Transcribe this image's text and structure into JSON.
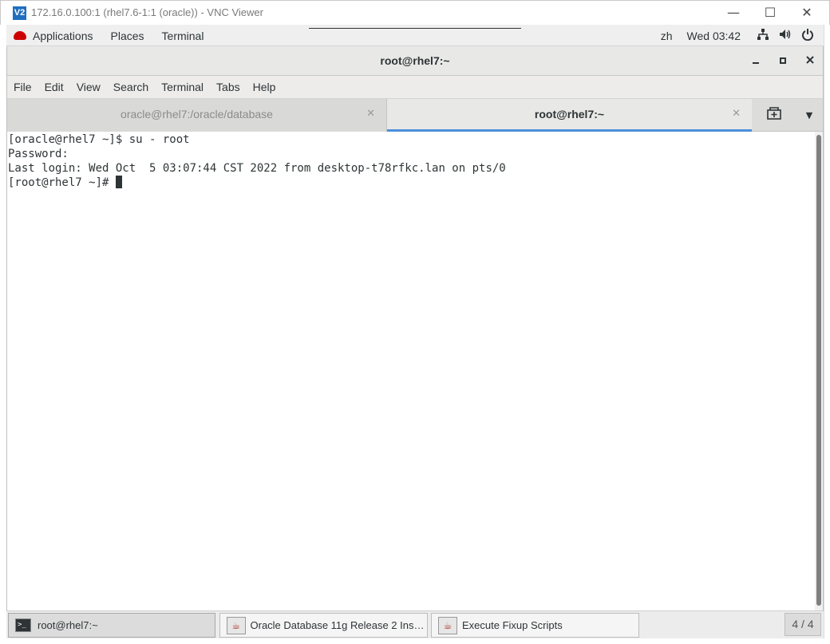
{
  "vnc": {
    "logo": "V2",
    "title": "172.16.0.100:1 (rhel7.6-1:1 (oracle)) - VNC Viewer",
    "minimize_glyph": "—",
    "maximize_glyph": "☐",
    "close_glyph": "✕"
  },
  "gnome_bar": {
    "menus": [
      "Applications",
      "Places",
      "Terminal"
    ],
    "language": "zh",
    "clock": "Wed 03:42",
    "tray_icons": [
      "network-icon",
      "volume-icon",
      "power-icon"
    ]
  },
  "terminal": {
    "window_title": "root@rhel7:~",
    "menu": [
      "File",
      "Edit",
      "View",
      "Search",
      "Terminal",
      "Tabs",
      "Help"
    ],
    "tabs": [
      {
        "label": "oracle@rhel7:/oracle/database",
        "active": false
      },
      {
        "label": "root@rhel7:~",
        "active": true
      }
    ],
    "lines": [
      "[oracle@rhel7 ~]$ su - root",
      "Password:",
      "Last login: Wed Oct  5 03:07:44 CST 2022 from desktop-t78rfkc.lan on pts/0",
      "[root@rhel7 ~]# "
    ]
  },
  "taskbar": {
    "tasks": [
      {
        "label": "root@rhel7:~",
        "icon": "terminal-icon",
        "active": true
      },
      {
        "label": "Oracle Database 11g Release 2 Insta...",
        "icon": "java-installer-icon",
        "active": false
      },
      {
        "label": "Execute Fixup Scripts",
        "icon": "java-installer-icon",
        "active": false
      }
    ],
    "workspace": "4 / 4"
  },
  "colors": {
    "active_tab_underline": "#4a90d9",
    "terminal_text": "#2e3436",
    "vnc_logo": "#1f6fbf",
    "redhat": "#cc0000"
  }
}
